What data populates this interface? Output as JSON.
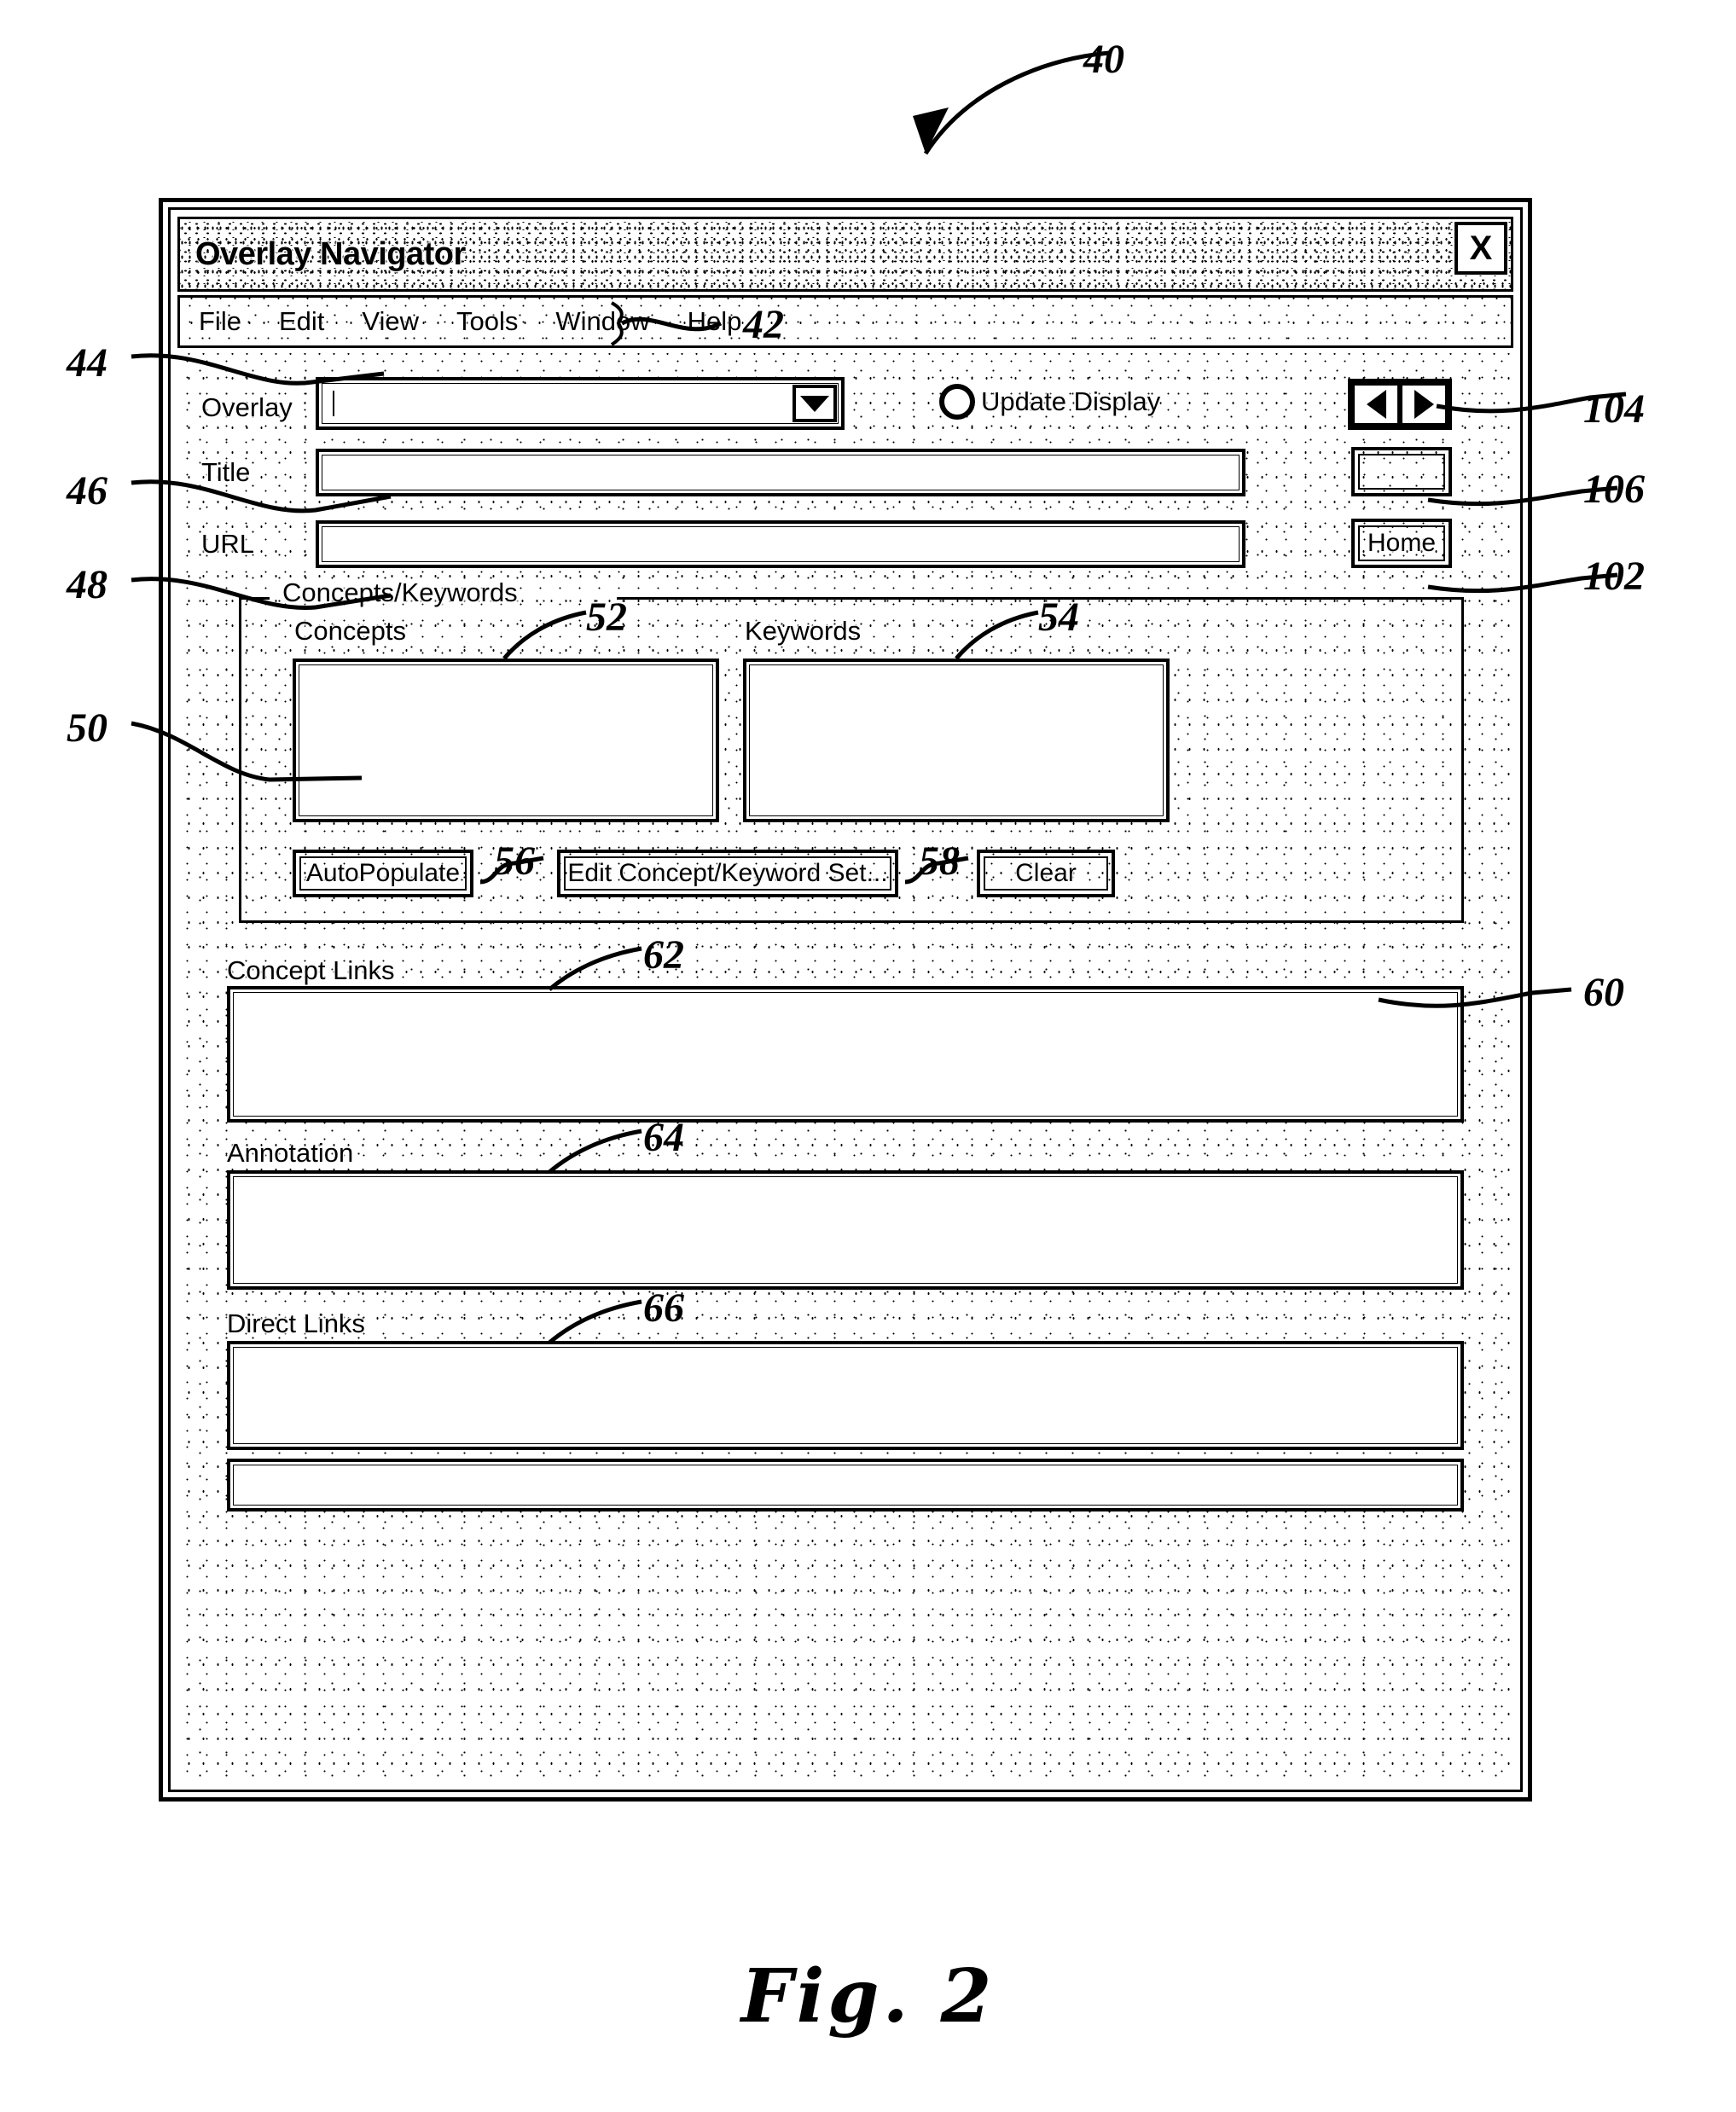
{
  "figure": {
    "caption": "Fig. 2",
    "system_ref": "40"
  },
  "window": {
    "title": "Overlay Navigator",
    "close_icon": "X",
    "menubar": {
      "ref": "42",
      "items": [
        {
          "label": "File"
        },
        {
          "label": "Edit"
        },
        {
          "label": "View"
        },
        {
          "label": "Tools"
        },
        {
          "label": "Window"
        },
        {
          "label": "Help"
        }
      ]
    },
    "overlay_row": {
      "ref": "44",
      "label": "Overlay",
      "combo_value": "",
      "combo_placeholder": "",
      "caret_icon": "chevron-down-icon",
      "update_display": {
        "label": "Update Display",
        "selected": false
      },
      "nav": {
        "ref": "104",
        "prev_icon": "triangle-left-icon",
        "next_icon": "triangle-right-icon"
      }
    },
    "title_row": {
      "ref": "46",
      "label": "Title",
      "value": "",
      "side_button": {
        "ref": "106",
        "label": ""
      }
    },
    "url_row": {
      "ref": "48",
      "label": "URL",
      "value": "",
      "side_button": {
        "ref": "102",
        "label": "Home"
      }
    },
    "concepts_keywords_group": {
      "ref": "50",
      "title": "Concepts/Keywords",
      "concepts": {
        "ref": "52",
        "label": "Concepts",
        "items": []
      },
      "keywords": {
        "ref": "54",
        "label": "Keywords",
        "items": []
      },
      "buttons": [
        {
          "ref": "56",
          "label": "AutoPopulate",
          "name": "autopopulate-button"
        },
        {
          "ref": "58",
          "label": "Edit Concept/Keyword Set...",
          "name": "edit-concept-keyword-set-button"
        },
        {
          "ref": "60",
          "label": "Clear",
          "name": "clear-button"
        }
      ]
    },
    "concept_links": {
      "ref": "62",
      "label": "Concept Links",
      "value": ""
    },
    "annotation": {
      "ref": "64",
      "label": "Annotation",
      "value": ""
    },
    "direct_links": {
      "ref": "66",
      "label": "Direct Links",
      "value": ""
    },
    "status_bar": {
      "value": ""
    }
  }
}
